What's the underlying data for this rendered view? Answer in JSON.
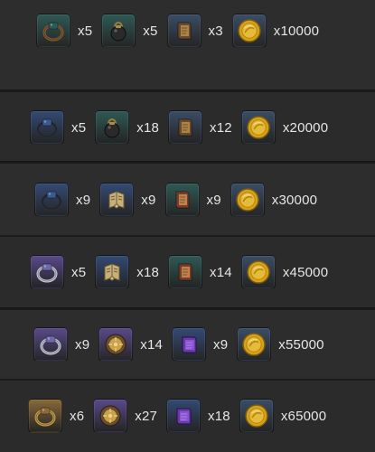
{
  "rows": [
    {
      "items": [
        {
          "icon": "bronze-ring-icon",
          "qty": "x5",
          "bg": "#2f5a55"
        },
        {
          "icon": "pouch-icon",
          "qty": "x5",
          "bg": "#2f5a55"
        },
        {
          "icon": "scroll-book-icon",
          "qty": "x3",
          "bg": "#3b4d66"
        },
        {
          "icon": "gold-coin-icon",
          "qty": "x10000",
          "bg": "#3b4d66"
        }
      ]
    },
    {
      "items": [
        {
          "icon": "dark-ring-icon",
          "qty": "x5",
          "bg": "#344a74"
        },
        {
          "icon": "bomb-pouch-icon",
          "qty": "x18",
          "bg": "#2f5a55"
        },
        {
          "icon": "scroll-book-icon",
          "qty": "x12",
          "bg": "#3b4d66"
        },
        {
          "icon": "gold-coin-icon",
          "qty": "x20000",
          "bg": "#3b4d66"
        }
      ]
    },
    {
      "items": [
        {
          "icon": "dark-ring-icon",
          "qty": "x9",
          "bg": "#344a74"
        },
        {
          "icon": "map-scroll-icon",
          "qty": "x9",
          "bg": "#344a74"
        },
        {
          "icon": "tome-icon",
          "qty": "x9",
          "bg": "#2f5a55"
        },
        {
          "icon": "gold-coin-icon",
          "qty": "x30000",
          "bg": "#3b4d66"
        }
      ]
    },
    {
      "items": [
        {
          "icon": "silver-ring-icon",
          "qty": "x5",
          "bg": "#5a4a8a"
        },
        {
          "icon": "map-scroll-icon",
          "qty": "x18",
          "bg": "#344a74"
        },
        {
          "icon": "tome-icon",
          "qty": "x14",
          "bg": "#2f5a55"
        },
        {
          "icon": "gold-coin-icon",
          "qty": "x45000",
          "bg": "#3b4d66"
        }
      ]
    },
    {
      "items": [
        {
          "icon": "silver-ring-icon",
          "qty": "x9",
          "bg": "#5a4a8a"
        },
        {
          "icon": "ornate-medallion-icon",
          "qty": "x14",
          "bg": "#5a4a8a"
        },
        {
          "icon": "purple-tome-icon",
          "qty": "x9",
          "bg": "#344a74"
        },
        {
          "icon": "gold-coin-icon",
          "qty": "x55000",
          "bg": "#3b4d66"
        }
      ]
    },
    {
      "items": [
        {
          "icon": "gold-ring-icon",
          "qty": "x6",
          "bg": "#8a6a3a"
        },
        {
          "icon": "ornate-medallion-icon",
          "qty": "x27",
          "bg": "#5a4a8a"
        },
        {
          "icon": "purple-tome-icon",
          "qty": "x18",
          "bg": "#344a74"
        },
        {
          "icon": "gold-coin-icon",
          "qty": "x65000",
          "bg": "#3b4d66"
        }
      ]
    }
  ]
}
